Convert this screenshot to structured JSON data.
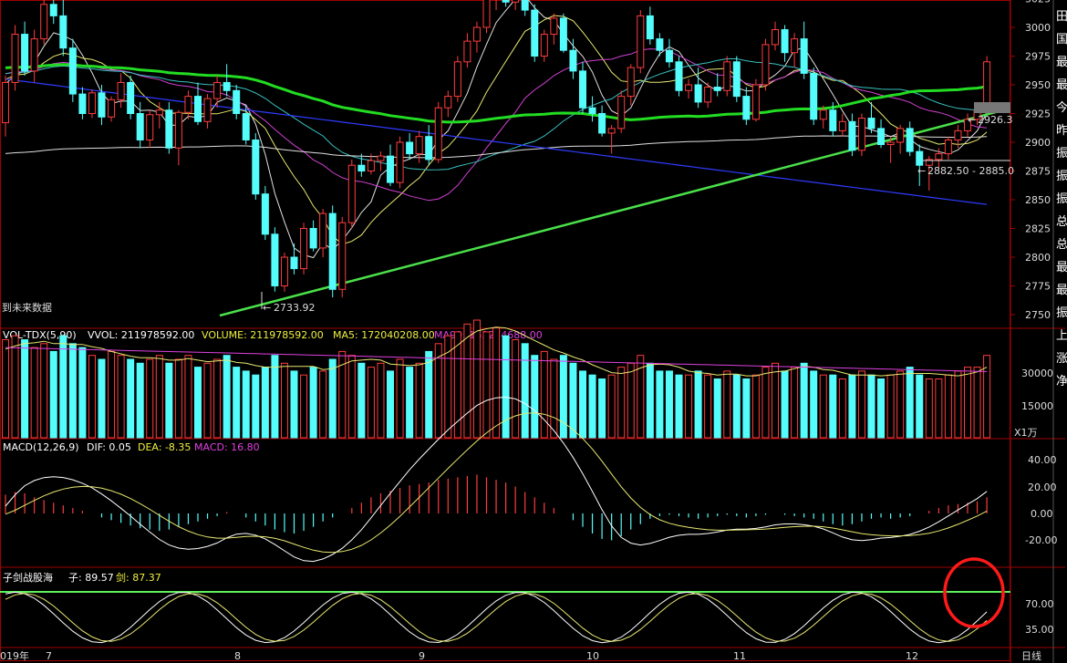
{
  "chart_data": {
    "type": "candlestick",
    "price_axis": {
      "ticks": [
        3025,
        3000,
        2975,
        2950,
        2925,
        2900,
        2875,
        2850,
        2825,
        2800,
        2775,
        2750
      ]
    },
    "annotations": {
      "low_label": "2733.92",
      "high_label": "2926.3",
      "range_label": "2882.50 - 2885.0",
      "future_data_label": "到未来数据"
    },
    "volume": {
      "header": [
        "VOL-TDX(5,90)",
        "VVOL: 211978592.00",
        "VOLUME: 211978592.00",
        "MA5: 172040208.00",
        "MA90: 163274688.00"
      ],
      "axis_ticks": [
        "30000",
        "15000"
      ],
      "unit": "X1万"
    },
    "macd": {
      "header": [
        "MACD(12,26,9)",
        "DIF: 0.05",
        "DEA: -8.35",
        "MACD: 16.80"
      ],
      "axis_ticks": [
        "40.00",
        "20.00",
        "0.00",
        "-20.00"
      ]
    },
    "osc": {
      "header": [
        "子剑战股海",
        "子: 89.57",
        "剑: 87.37"
      ],
      "axis_ticks": [
        "70.00",
        "35.00"
      ]
    },
    "x_axis": {
      "labels": [
        "019年",
        "7",
        "8",
        "9",
        "10",
        "11",
        "12"
      ],
      "period": "日线"
    },
    "side_chars": [
      "田",
      "国",
      "最",
      "最",
      "今",
      "昨",
      "振",
      "振",
      "振",
      "总",
      "总",
      "最",
      "最",
      "振",
      "上",
      "涨",
      "净"
    ],
    "colors": {
      "up": "#ff3c3c",
      "down": "#54fcfc",
      "ma_thick": "#22dd22",
      "ma_blue": "#2f3cff",
      "ma_white": "#e0e0e0",
      "ma_yellow": "#e8e870",
      "ma_magenta": "#d040d0",
      "ma_cyan": "#3ac0c0",
      "trendline": "#4ae04a",
      "frame": "#a00000",
      "macd_pink": "#e040e0"
    },
    "candles": [
      [
        2917,
        2958,
        2905,
        2952
      ],
      [
        2952,
        3002,
        2945,
        2994
      ],
      [
        2994,
        3005,
        2958,
        2962
      ],
      [
        2962,
        2998,
        2952,
        2990
      ],
      [
        2990,
        3028,
        2985,
        3020
      ],
      [
        3020,
        3035,
        3003,
        3010
      ],
      [
        3010,
        3024,
        2975,
        2982
      ],
      [
        2982,
        2990,
        2935,
        2942
      ],
      [
        2942,
        2948,
        2920,
        2925
      ],
      [
        2925,
        2946,
        2921,
        2943
      ],
      [
        2943,
        2950,
        2915,
        2922
      ],
      [
        2922,
        2940,
        2918,
        2937
      ],
      [
        2937,
        2960,
        2930,
        2952
      ],
      [
        2952,
        2958,
        2920,
        2925
      ],
      [
        2925,
        2935,
        2895,
        2902
      ],
      [
        2902,
        2928,
        2895,
        2924
      ],
      [
        2924,
        2935,
        2912,
        2928
      ],
      [
        2928,
        2935,
        2890,
        2895
      ],
      [
        2895,
        2928,
        2880,
        2926
      ],
      [
        2926,
        2945,
        2920,
        2940
      ],
      [
        2940,
        2952,
        2915,
        2918
      ],
      [
        2918,
        2942,
        2912,
        2938
      ],
      [
        2938,
        2958,
        2930,
        2952
      ],
      [
        2952,
        2968,
        2940,
        2945
      ],
      [
        2945,
        2950,
        2920,
        2925
      ],
      [
        2925,
        2932,
        2898,
        2902
      ],
      [
        2902,
        2908,
        2850,
        2855
      ],
      [
        2855,
        2862,
        2815,
        2820
      ],
      [
        2820,
        2826,
        2770,
        2775
      ],
      [
        2775,
        2804,
        2770,
        2800
      ],
      [
        2800,
        2812,
        2785,
        2790
      ],
      [
        2790,
        2830,
        2785,
        2825
      ],
      [
        2825,
        2832,
        2805,
        2808
      ],
      [
        2808,
        2842,
        2800,
        2838
      ],
      [
        2838,
        2845,
        2765,
        2772
      ],
      [
        2772,
        2835,
        2765,
        2830
      ],
      [
        2830,
        2885,
        2825,
        2880
      ],
      [
        2880,
        2890,
        2870,
        2875
      ],
      [
        2875,
        2890,
        2872,
        2884
      ],
      [
        2884,
        2892,
        2875,
        2888
      ],
      [
        2888,
        2898,
        2862,
        2865
      ],
      [
        2865,
        2905,
        2860,
        2900
      ],
      [
        2900,
        2908,
        2885,
        2890
      ],
      [
        2890,
        2910,
        2882,
        2905
      ],
      [
        2905,
        2915,
        2880,
        2885
      ],
      [
        2885,
        2935,
        2882,
        2930
      ],
      [
        2930,
        2945,
        2922,
        2940
      ],
      [
        2940,
        2975,
        2935,
        2970
      ],
      [
        2970,
        2995,
        2965,
        2988
      ],
      [
        2988,
        3005,
        2978,
        3000
      ],
      [
        3000,
        3035,
        2995,
        3028
      ],
      [
        3028,
        3040,
        3015,
        3035
      ],
      [
        3035,
        3042,
        3018,
        3022
      ],
      [
        3022,
        3040,
        3015,
        3038
      ],
      [
        3038,
        3042,
        3010,
        3015
      ],
      [
        3015,
        3020,
        2970,
        2975
      ],
      [
        2975,
        2998,
        2970,
        2994
      ],
      [
        2994,
        3012,
        2985,
        3008
      ],
      [
        3008,
        3012,
        2978,
        2980
      ],
      [
        2980,
        2990,
        2955,
        2962
      ],
      [
        2962,
        2970,
        2925,
        2930
      ],
      [
        2930,
        2940,
        2918,
        2925
      ],
      [
        2925,
        2932,
        2905,
        2908
      ],
      [
        2908,
        2915,
        2890,
        2912
      ],
      [
        2912,
        2945,
        2908,
        2940
      ],
      [
        2940,
        2968,
        2932,
        2965
      ],
      [
        2965,
        3015,
        2960,
        3010
      ],
      [
        3010,
        3018,
        2985,
        2990
      ],
      [
        2990,
        2995,
        2975,
        2980
      ],
      [
        2980,
        2990,
        2965,
        2970
      ],
      [
        2970,
        2975,
        2940,
        2945
      ],
      [
        2945,
        2955,
        2938,
        2950
      ],
      [
        2950,
        2965,
        2930,
        2935
      ],
      [
        2935,
        2952,
        2930,
        2948
      ],
      [
        2948,
        2960,
        2940,
        2945
      ],
      [
        2945,
        2975,
        2940,
        2970
      ],
      [
        2970,
        2975,
        2935,
        2940
      ],
      [
        2940,
        2948,
        2915,
        2920
      ],
      [
        2920,
        2955,
        2918,
        2950
      ],
      [
        2950,
        2990,
        2945,
        2985
      ],
      [
        2985,
        3005,
        2980,
        2998
      ],
      [
        2998,
        3002,
        2970,
        2978
      ],
      [
        2978,
        2995,
        2965,
        2990
      ],
      [
        2990,
        3005,
        2955,
        2960
      ],
      [
        2960,
        2965,
        2915,
        2920
      ],
      [
        2920,
        2932,
        2912,
        2928
      ],
      [
        2928,
        2935,
        2905,
        2910
      ],
      [
        2910,
        2925,
        2905,
        2918
      ],
      [
        2918,
        2925,
        2888,
        2893
      ],
      [
        2893,
        2925,
        2888,
        2921
      ],
      [
        2921,
        2935,
        2908,
        2912
      ],
      [
        2912,
        2920,
        2895,
        2898
      ],
      [
        2898,
        2905,
        2882,
        2900
      ],
      [
        2900,
        2915,
        2890,
        2912
      ],
      [
        2912,
        2918,
        2888,
        2892
      ],
      [
        2892,
        2898,
        2862,
        2880
      ],
      [
        2880,
        2888,
        2858,
        2885
      ],
      [
        2885,
        2895,
        2876,
        2890
      ],
      [
        2890,
        2905,
        2885,
        2902
      ],
      [
        2902,
        2915,
        2895,
        2910
      ],
      [
        2910,
        2925,
        2905,
        2920
      ],
      [
        2920,
        2932,
        2915,
        2928
      ],
      [
        2928,
        2975,
        2925,
        2970
      ]
    ],
    "volume_values": [
      2.5,
      2.6,
      2.5,
      2.3,
      2.4,
      2.2,
      2.6,
      2.4,
      2.3,
      2.1,
      2.0,
      2.2,
      2.1,
      2.0,
      1.9,
      2.0,
      2.1,
      1.9,
      2.0,
      2.1,
      1.8,
      1.9,
      2.0,
      2.1,
      1.8,
      1.7,
      1.6,
      1.8,
      2.1,
      1.9,
      1.7,
      1.6,
      1.8,
      1.7,
      2.0,
      2.2,
      2.1,
      1.9,
      1.8,
      1.9,
      1.7,
      2.0,
      1.8,
      1.9,
      2.2,
      2.4,
      2.6,
      2.7,
      2.9,
      3.0,
      2.7,
      2.8,
      2.6,
      2.5,
      2.4,
      2.1,
      2.2,
      2.0,
      2.1,
      1.9,
      1.7,
      1.6,
      1.5,
      1.6,
      1.8,
      1.9,
      2.1,
      1.9,
      1.7,
      1.7,
      1.6,
      1.6,
      1.7,
      1.6,
      1.5,
      1.7,
      1.6,
      1.5,
      1.6,
      1.8,
      1.9,
      1.7,
      1.8,
      1.9,
      1.7,
      1.6,
      1.6,
      1.5,
      1.6,
      1.7,
      1.6,
      1.5,
      1.6,
      1.7,
      1.8,
      1.6,
      1.5,
      1.5,
      1.6,
      1.7,
      1.8,
      1.8,
      2.1
    ],
    "macd_hist": [
      14,
      16,
      15,
      12,
      10,
      8,
      6,
      4,
      2,
      0,
      -3,
      -5,
      -7,
      -9,
      -11,
      -12,
      -13,
      -12,
      -10,
      -8,
      -6,
      -4,
      -2,
      1,
      0,
      -3,
      -6,
      -9,
      -12,
      -14,
      -15,
      -13,
      -10,
      -6,
      -3,
      0,
      4,
      8,
      12,
      15,
      17,
      19,
      21,
      22,
      23,
      25,
      26,
      27,
      28,
      29,
      27,
      25,
      23,
      20,
      16,
      12,
      8,
      4,
      0,
      -5,
      -10,
      -15,
      -19,
      -20,
      -17,
      -12,
      -8,
      -4,
      -2,
      -1,
      -2,
      -3,
      -4,
      -3,
      -2,
      -1,
      -2,
      -3,
      -2,
      -1,
      0,
      -1,
      -2,
      -3,
      -4,
      -6,
      -8,
      -9,
      -8,
      -6,
      -4,
      -3,
      -4,
      -3,
      -2,
      0,
      2,
      4,
      6,
      7,
      8,
      9,
      12
    ]
  }
}
